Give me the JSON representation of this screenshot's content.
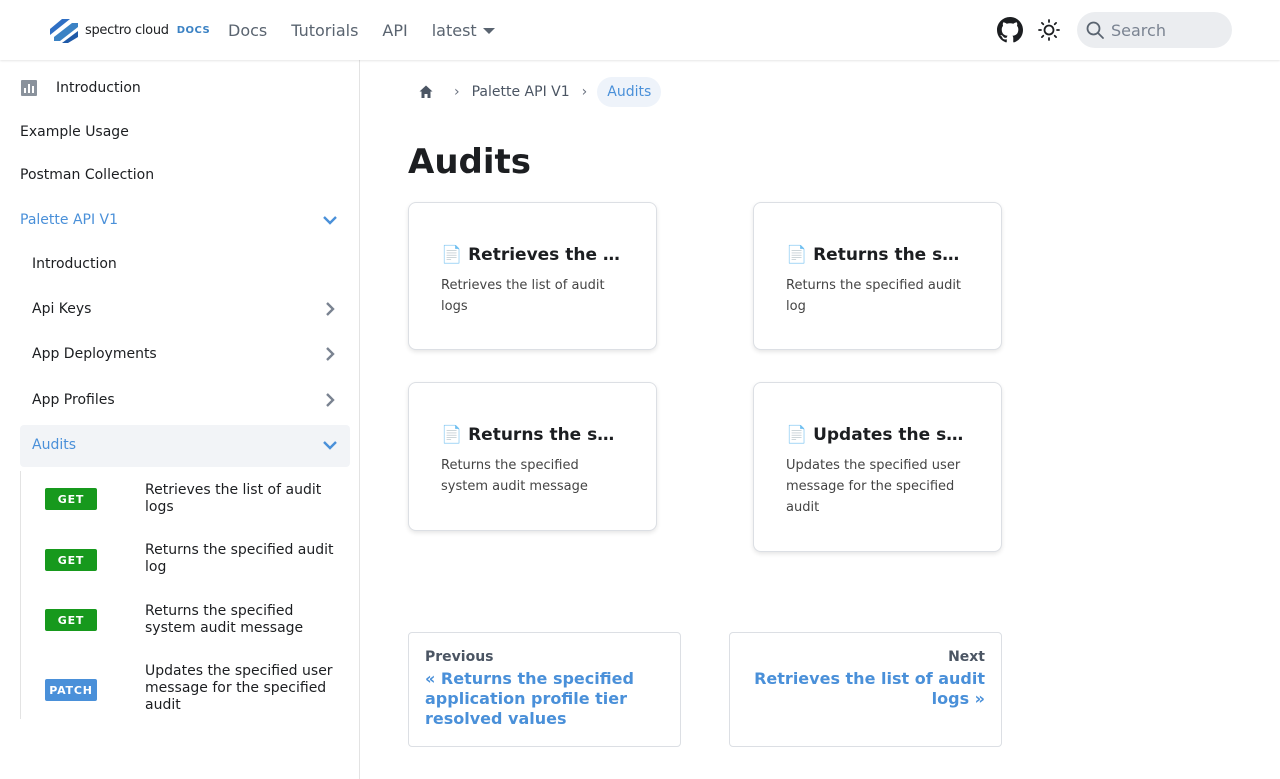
{
  "navbar": {
    "logo_text": "spectro cloud",
    "logo_docs": "DOCS",
    "links": [
      "Docs",
      "Tutorials",
      "API"
    ],
    "version": "latest",
    "search_placeholder": "Search"
  },
  "sidebar": {
    "top": [
      "Introduction",
      "Example Usage",
      "Postman Collection"
    ],
    "section": "Palette API V1",
    "items": [
      "Introduction",
      "Api Keys",
      "App Deployments",
      "App Profiles",
      "Audits"
    ],
    "endpoints": [
      {
        "method": "GET",
        "label": "Retrieves the list of audit logs"
      },
      {
        "method": "GET",
        "label": "Returns the specified audit log"
      },
      {
        "method": "GET",
        "label": "Returns the specified system audit message"
      },
      {
        "method": "PATCH",
        "label": "Updates the specified user message for the specified audit"
      }
    ]
  },
  "breadcrumb": {
    "parent": "Palette API V1",
    "current": "Audits"
  },
  "page": {
    "title": "Audits"
  },
  "cards": [
    {
      "title": "📄 Retrieves the list of audit logs",
      "desc": "Retrieves the list of audit logs"
    },
    {
      "title": "📄 Returns the specified audit log",
      "desc": "Returns the specified audit log"
    },
    {
      "title": "📄 Returns the specified system audit message",
      "desc": "Returns the specified system audit message"
    },
    {
      "title": "📄 Updates the specified user message for the specified audit",
      "desc": "Updates the specified user message for the specified audit"
    }
  ],
  "pagination": {
    "prev_label": "Previous",
    "prev_title": "« Returns the specified application profile tier resolved values",
    "next_label": "Next",
    "next_title": "Retrieves the list of audit logs »"
  },
  "colors": {
    "accent": "#4a90d9",
    "get": "#17991d",
    "patch": "#4a90d9"
  }
}
